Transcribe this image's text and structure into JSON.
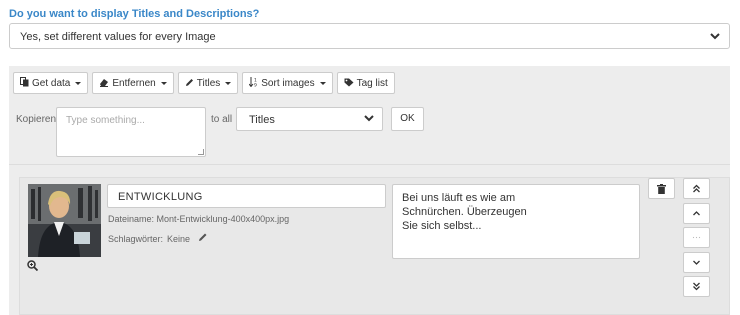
{
  "question": "Do you want to display Titles and Descriptions?",
  "display_select": {
    "value": "Yes, set different values for every Image",
    "icon": "chevron-down-icon"
  },
  "toolbar": {
    "buttons": [
      {
        "label": "Get data",
        "icon": "copy-icon",
        "dropdown": true
      },
      {
        "label": "Entfernen",
        "icon": "eraser-icon",
        "dropdown": true
      },
      {
        "label": "Titles",
        "icon": "pencil-icon",
        "dropdown": true
      },
      {
        "label": "Sort images",
        "icon": "sort-icon",
        "dropdown": true
      },
      {
        "label": "Tag list",
        "icon": "tag-icon",
        "dropdown": false
      }
    ]
  },
  "copy_bar": {
    "label": "Kopieren",
    "placeholder": "Type something...",
    "to_all_label": "to all",
    "target_value": "Titles",
    "ok_label": "OK"
  },
  "item": {
    "title": "ENTWICKLUNG",
    "filename_label": "Dateiname:",
    "filename": "Mont-Entwicklung-400x400px.jpg",
    "keywords_label": "Schlagwörter:",
    "keywords": "Keine",
    "description": "Bei uns läuft es wie am\nSchnürchen. Überzeugen\nSie sich selbst...",
    "move_buttons": [
      "move-top",
      "move-up",
      "move-placeholder",
      "move-down",
      "move-bottom"
    ]
  }
}
